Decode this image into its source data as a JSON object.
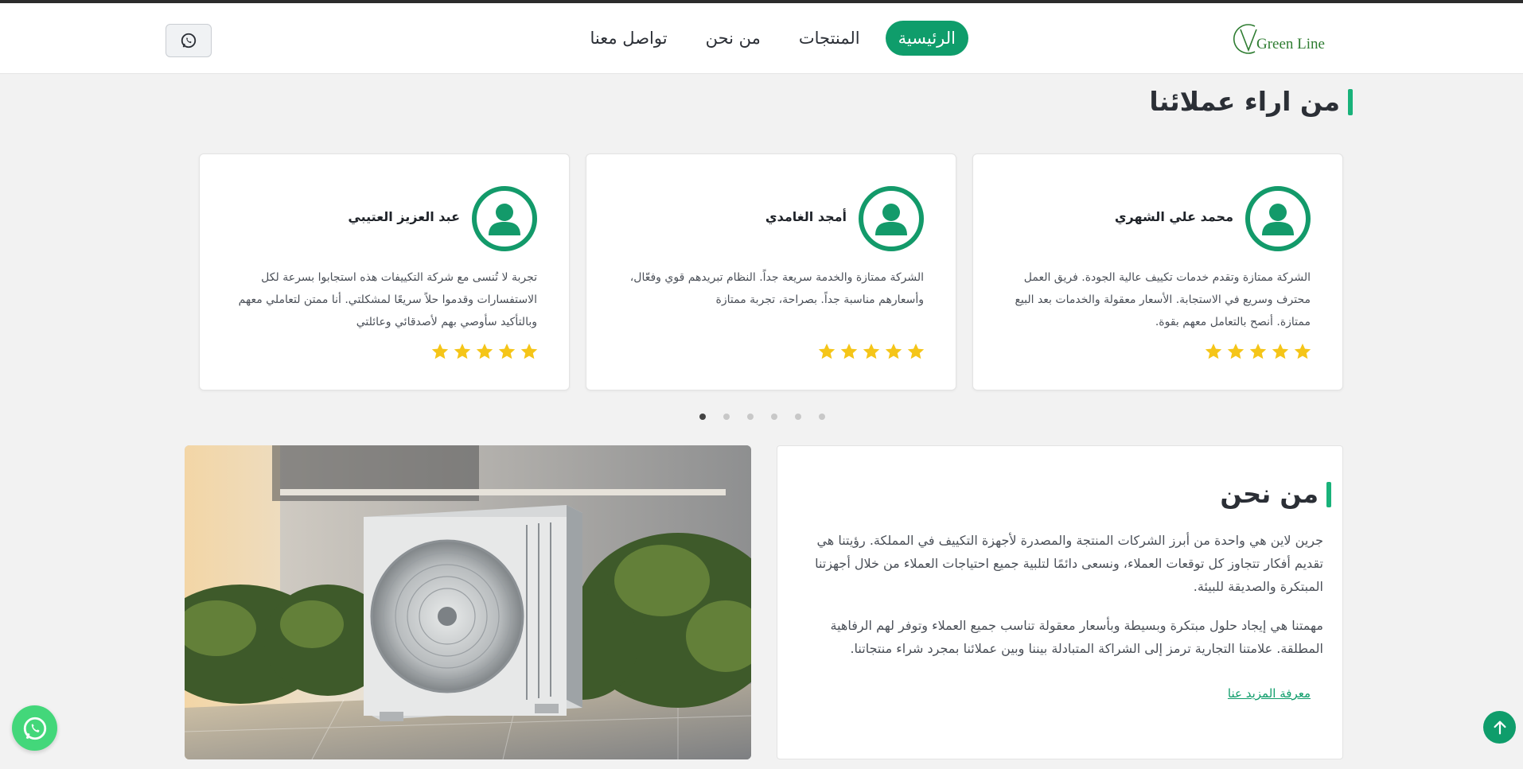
{
  "brand": {
    "logo_text": "Green Line",
    "accent_color": "#0f9d6b",
    "logo_color": "#2f7d32"
  },
  "nav": {
    "items": [
      {
        "label": "الرئيسية",
        "active": true
      },
      {
        "label": "المنتجات",
        "active": false
      },
      {
        "label": "من نحن",
        "active": false
      },
      {
        "label": "تواصل معنا",
        "active": false
      }
    ],
    "whatsapp_icon": "whatsapp-icon"
  },
  "testimonials": {
    "title": "من اراء عملائنا",
    "cards": [
      {
        "name": "محمد علي الشهري",
        "text": "الشركة ممتازة وتقدم خدمات تكييف عالية الجودة. فريق العمل محترف وسريع في الاستجابة. الأسعار معقولة والخدمات بعد البيع ممتازة. أنصح بالتعامل معهم بقوة.",
        "rating": 5
      },
      {
        "name": "أمجد الغامدي",
        "text": "الشركة ممتازة والخدمة سريعة جداً. النظام تبريدهم قوي وفعّال، وأسعارهم مناسبة جداً. بصراحة، تجربة ممتازة",
        "rating": 5
      },
      {
        "name": "عبد العزيز العتيبي",
        "text": "تجربة لا تُنسى مع شركة التكييفات هذه استجابوا بسرعة لكل الاستفسارات وقدموا حلاً سريعًا لمشكلتي. أنا ممتن لتعاملي معهم وبالتأكيد سأوصي بهم لأصدقائي وعائلتي",
        "rating": 5
      }
    ],
    "pagination": {
      "total": 6,
      "active_index": 0
    },
    "star_color": "#f5c518"
  },
  "about": {
    "title": "من نحن",
    "paragraph_1": "جرين لاين هي واحدة من أبرز الشركات المنتجة والمصدرة لأجهزة التكييف في المملكة. رؤيتنا هي تقديم أفكار تتجاوز كل توقعات العملاء، ونسعى دائمًا لتلبية جميع احتياجات العملاء من خلال أجهزتنا المبتكرة والصديقة للبيئة.",
    "paragraph_2": "مهمتنا هي إيجاد حلول مبتكرة وبسيطة وبأسعار معقولة تناسب جميع العملاء وتوفر لهم الرفاهية المطلقة. علامتنا التجارية ترمز إلى الشراكة المتبادلة بيننا وبين عملائنا بمجرد شراء منتجاتنا.",
    "more_link": "معرفة المزيد عنا",
    "image_alt": "air-conditioner-outdoor-unit"
  }
}
